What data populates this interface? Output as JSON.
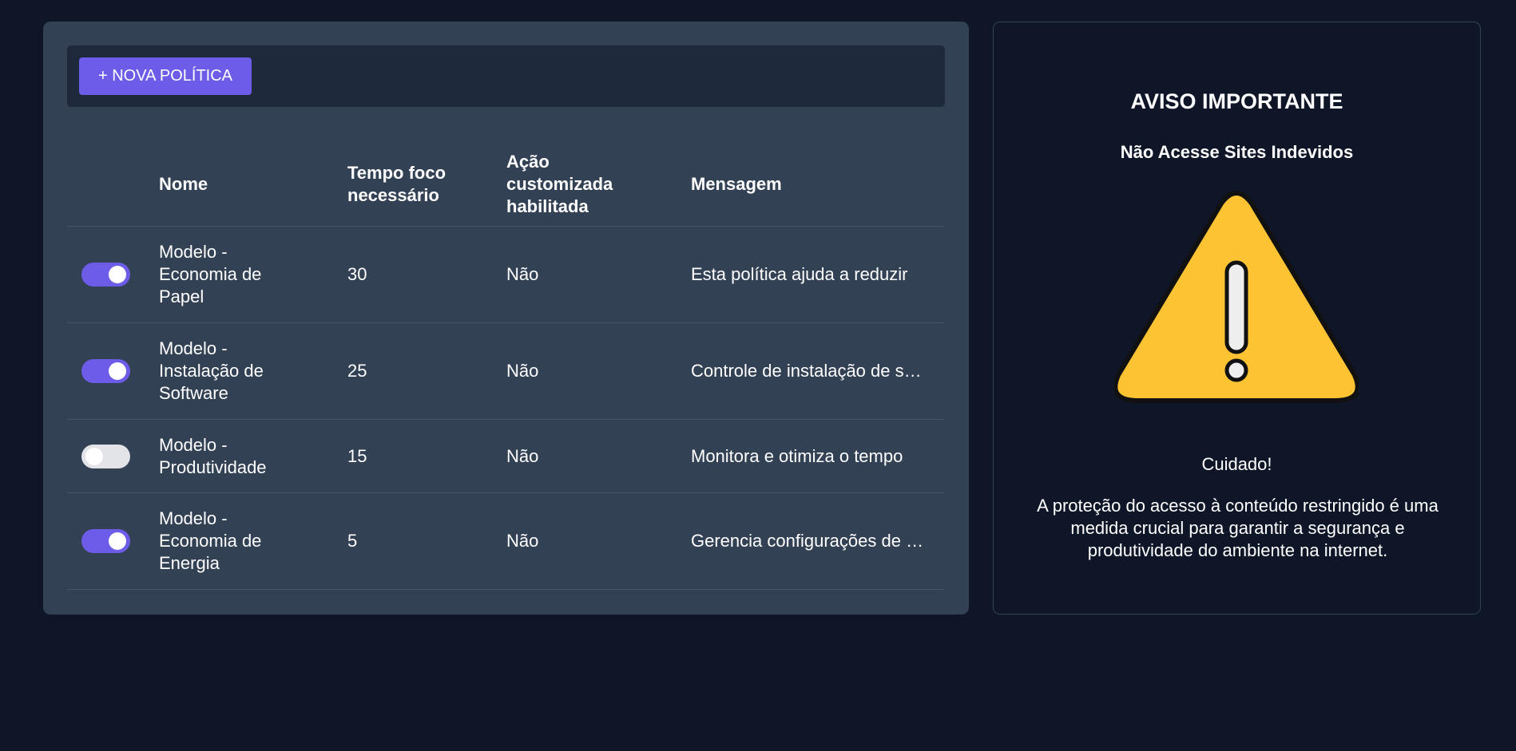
{
  "toolbar": {
    "new_policy_label": "+ NOVA POLÍTICA"
  },
  "table": {
    "columns": {
      "name": "Nome",
      "focus_time": "Tempo foco necessário",
      "custom_action": "Ação customizada habilitada",
      "message": "Mensagem"
    },
    "rows": [
      {
        "enabled": true,
        "name": "Modelo - Economia de Papel",
        "focus_time": "30",
        "custom_action": "Não",
        "message": "Esta política ajuda a reduzir"
      },
      {
        "enabled": true,
        "name": "Modelo - Instalação de Software",
        "focus_time": "25",
        "custom_action": "Não",
        "message": "Controle de instalação de software"
      },
      {
        "enabled": false,
        "name": "Modelo - Produtividade",
        "focus_time": "15",
        "custom_action": "Não",
        "message": "Monitora e otimiza o tempo"
      },
      {
        "enabled": true,
        "name": "Modelo - Economia de Energia",
        "focus_time": "5",
        "custom_action": "Não",
        "message": "Gerencia configurações de energia"
      }
    ]
  },
  "warning": {
    "title": "AVISO IMPORTANTE",
    "subtitle": "Não Acesse Sites Indevidos",
    "icon": "warning-triangle-icon",
    "caution": "Cuidado!",
    "body": "A proteção do acesso à conteúdo restringido é uma medida crucial para garantir a segurança e produtividade do ambiente na internet."
  },
  "colors": {
    "background": "#0f1628",
    "panel": "#334155",
    "toolbar": "#1e293b",
    "accent": "#6c5ce7",
    "toggle_off": "#e2e4e8",
    "warning_yellow": "#fdc333"
  }
}
